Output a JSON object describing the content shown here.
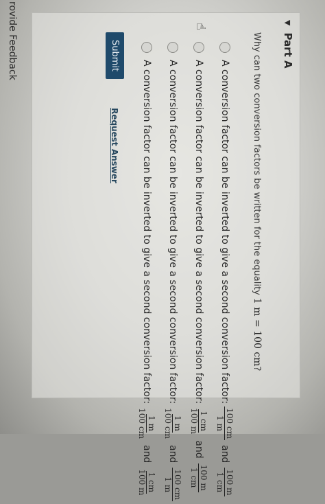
{
  "part": {
    "caret_icon": "triangle-down-icon",
    "title": "Part A"
  },
  "question": {
    "text": "Why can two conversion factors be written for the equality ",
    "lhs": "1 m",
    "eq": " = ",
    "rhs": "100 cm",
    "end": "?"
  },
  "options": [
    {
      "text": "A conversion factor can be inverted to give a second conversion factor:",
      "f1_num": "100 cm",
      "f1_den": "1 m",
      "and": "and",
      "f2_num": "100 m",
      "f2_den": "1 cm"
    },
    {
      "text": "A conversion factor can be inverted to give a second conversion factor:",
      "f1_num": "1 cm",
      "f1_den": "100 m",
      "and": "and",
      "f2_num": "100 m",
      "f2_den": "1 cm"
    },
    {
      "text": "A conversion factor can be inverted to give a second conversion factor:",
      "f1_num": "1 m",
      "f1_den": "100 cm",
      "and": "and",
      "f2_num": "100 cm",
      "f2_den": "1 m"
    },
    {
      "text": "A conversion factor can be inverted to give a second conversion factor:",
      "f1_num": "1 m",
      "f1_den": "100 cm",
      "and": "and",
      "f2_num": "1 cm",
      "f2_den": "100 m"
    }
  ],
  "pointer_icon": "hand-pointer-icon",
  "actions": {
    "submit": "Submit",
    "request": "Request Answer"
  },
  "footer": {
    "feedback": "rovide Feedback"
  }
}
